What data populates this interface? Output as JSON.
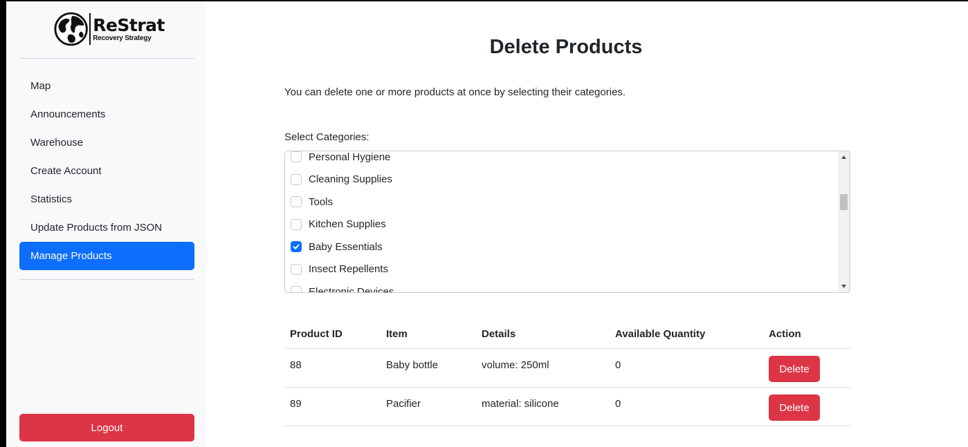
{
  "brand": {
    "title": "ReStrat",
    "subtitle": "Recovery Strategy"
  },
  "sidebar": {
    "items": [
      {
        "label": "Map"
      },
      {
        "label": "Announcements"
      },
      {
        "label": "Warehouse"
      },
      {
        "label": "Create Account"
      },
      {
        "label": "Statistics"
      },
      {
        "label": "Update Products from JSON"
      },
      {
        "label": "Manage Products",
        "active": true
      }
    ],
    "logout_label": "Logout"
  },
  "main": {
    "title": "Delete Products",
    "intro": "You can delete one or more products at once by selecting their categories.",
    "categories_label": "Select Categories:",
    "categories": [
      {
        "label": "Personal Hygiene",
        "checked": false
      },
      {
        "label": "Cleaning Supplies",
        "checked": false
      },
      {
        "label": "Tools",
        "checked": false
      },
      {
        "label": "Kitchen Supplies",
        "checked": false
      },
      {
        "label": "Baby Essentials",
        "checked": true
      },
      {
        "label": "Insect Repellents",
        "checked": false
      },
      {
        "label": "Electronic Devices",
        "checked": false
      }
    ],
    "table": {
      "headers": [
        "Product ID",
        "Item",
        "Details",
        "Available Quantity",
        "Action"
      ],
      "rows": [
        {
          "id": "88",
          "item": "Baby bottle",
          "details": "volume: 250ml",
          "quantity": "0",
          "action": "Delete"
        },
        {
          "id": "89",
          "item": "Pacifier",
          "details": "material: silicone",
          "quantity": "0",
          "action": "Delete"
        }
      ]
    }
  },
  "colors": {
    "primary": "#0d6efd",
    "danger": "#dc3545",
    "sidebar_bg": "#f8f9fa"
  }
}
